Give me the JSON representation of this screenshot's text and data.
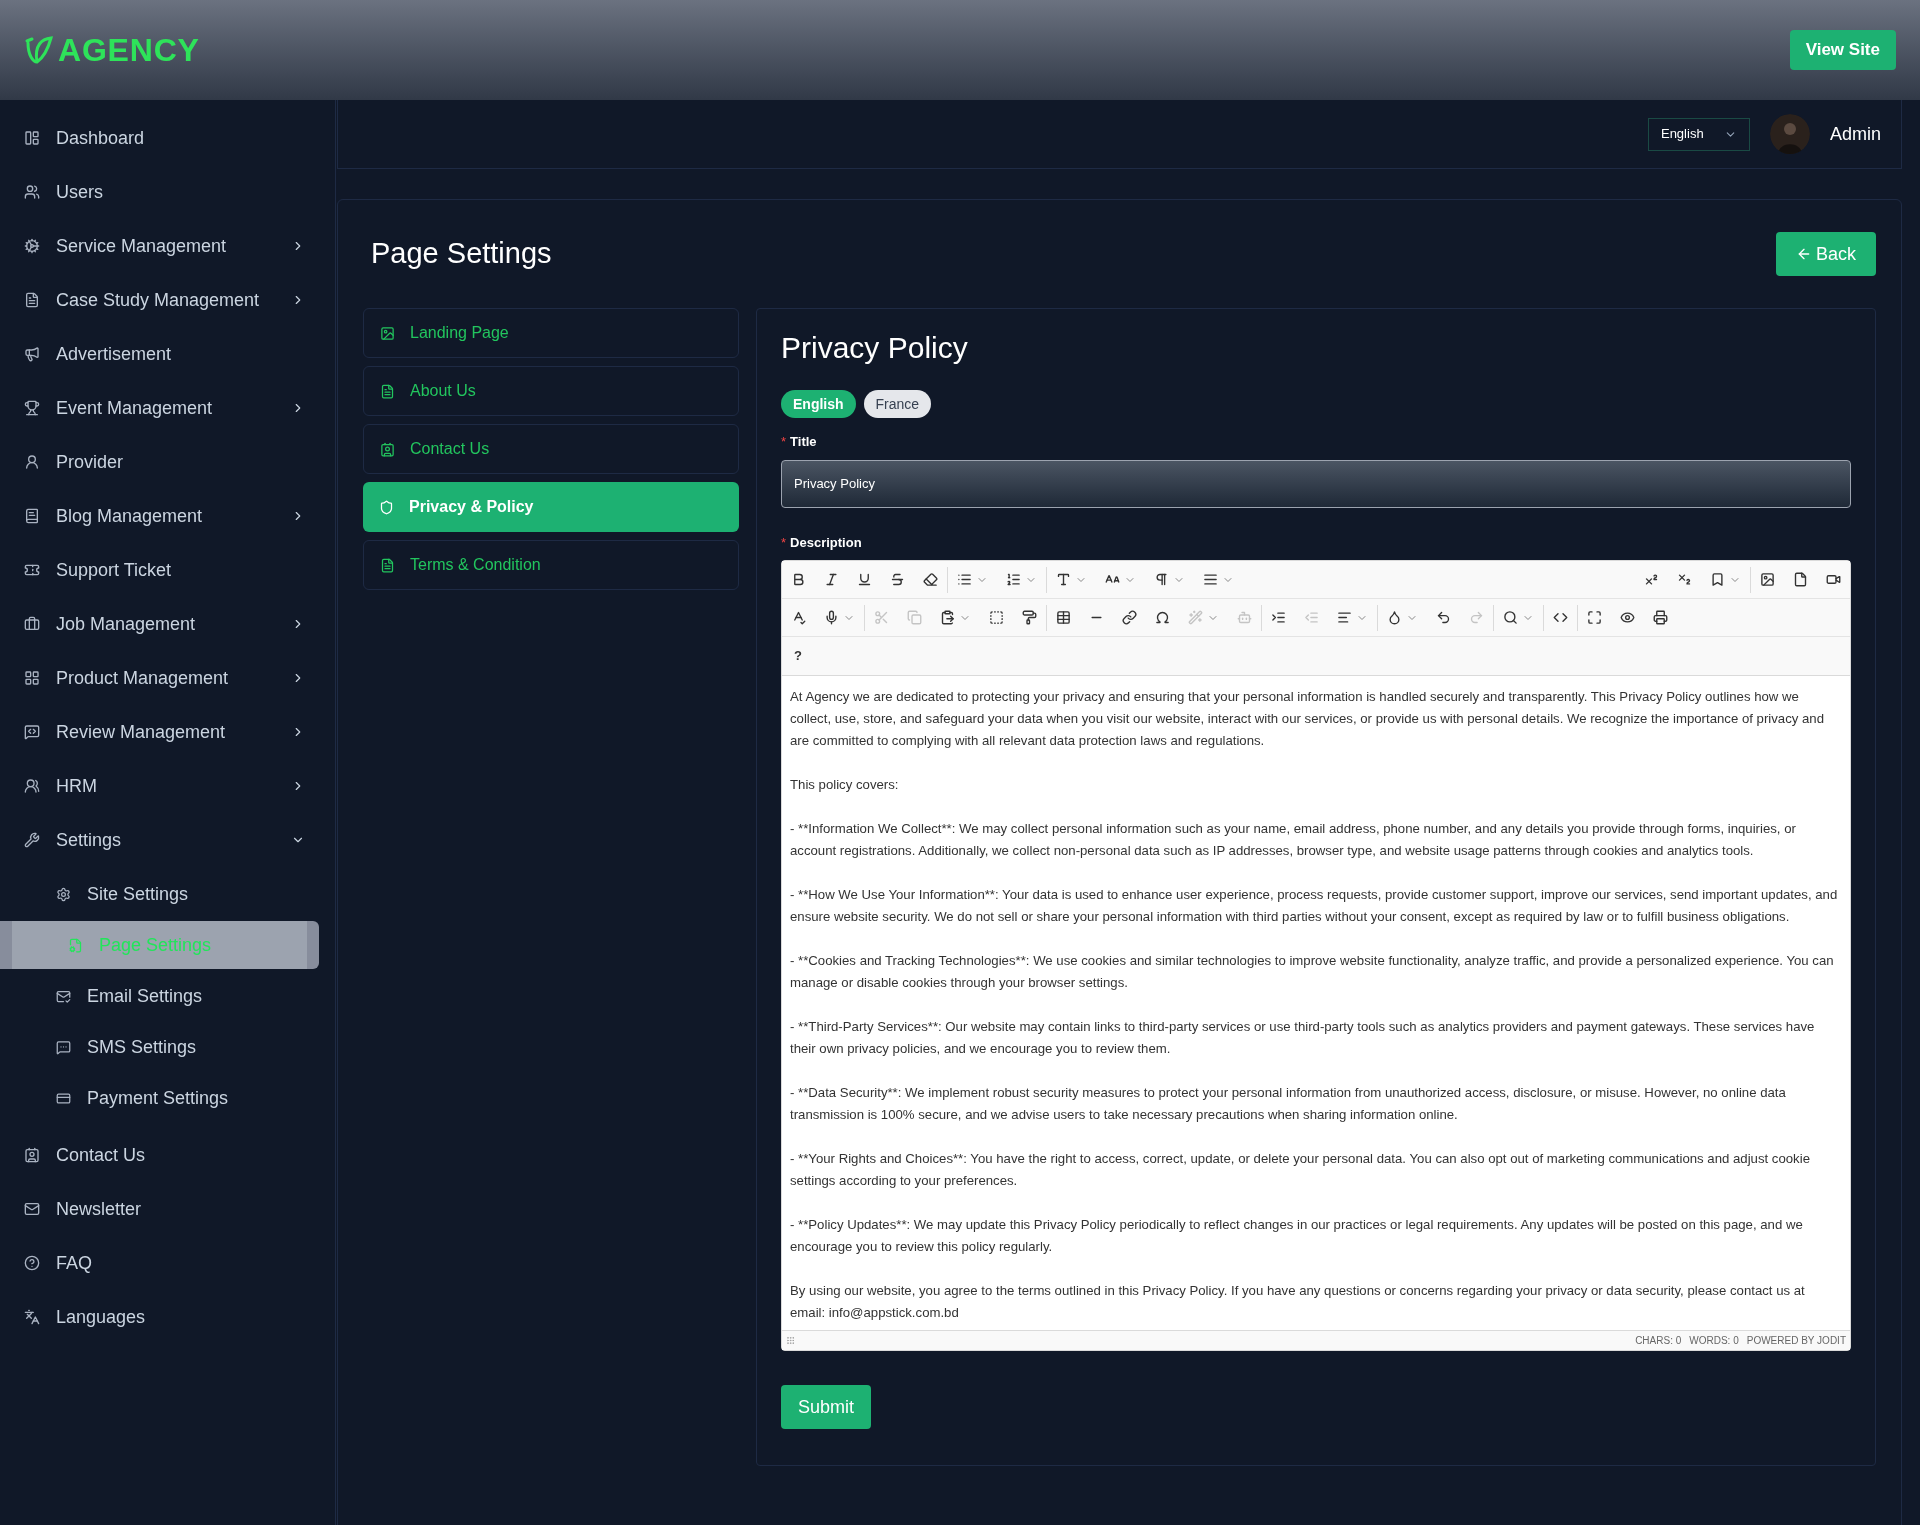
{
  "brand": {
    "name": "AGENCY"
  },
  "header": {
    "view_site": "View Site"
  },
  "sidebar": {
    "items": [
      {
        "label": "Dashboard",
        "selected": false
      },
      {
        "label": "Users",
        "selected": false
      },
      {
        "label": "Service Management",
        "expanded": false,
        "selected": false
      },
      {
        "label": "Case Study Management",
        "expanded": false,
        "selected": false
      },
      {
        "label": "Advertisement",
        "selected": false
      },
      {
        "label": "Event Management",
        "expanded": false,
        "selected": false
      },
      {
        "label": "Provider",
        "selected": false
      },
      {
        "label": "Blog Management",
        "expanded": false,
        "selected": false
      },
      {
        "label": "Support Ticket",
        "selected": false
      },
      {
        "label": "Job Management",
        "expanded": false,
        "selected": false
      },
      {
        "label": "Product Management",
        "expanded": false,
        "selected": false
      },
      {
        "label": "Review Management",
        "expanded": false,
        "selected": false
      },
      {
        "label": "HRM",
        "expanded": false,
        "selected": false
      },
      {
        "label": "Settings",
        "expanded": true,
        "selected": false,
        "children": [
          {
            "label": "Site Settings",
            "selected": false
          },
          {
            "label": "Page Settings",
            "selected": true
          },
          {
            "label": "Email Settings",
            "selected": false
          },
          {
            "label": "SMS Settings",
            "selected": false
          },
          {
            "label": "Payment Settings",
            "selected": false
          }
        ]
      },
      {
        "label": "Contact Us",
        "selected": false
      },
      {
        "label": "Newsletter",
        "selected": false
      },
      {
        "label": "FAQ",
        "selected": false
      },
      {
        "label": "Languages",
        "selected": false
      }
    ]
  },
  "topbar": {
    "language": "English",
    "user": "Admin"
  },
  "page": {
    "title": "Page Settings",
    "back": "Back"
  },
  "tabs": [
    {
      "label": "Landing Page",
      "selected": false
    },
    {
      "label": "About Us",
      "selected": false
    },
    {
      "label": "Contact Us",
      "selected": false
    },
    {
      "label": "Privacy & Policy",
      "selected": true
    },
    {
      "label": "Terms & Condition",
      "selected": false
    }
  ],
  "form": {
    "heading": "Privacy Policy",
    "languages": [
      {
        "label": "English",
        "selected": true
      },
      {
        "label": "France",
        "selected": false
      }
    ],
    "title_required": "*",
    "title_label": "Title",
    "title_value": "Privacy Policy",
    "description_required": "*",
    "description_label": "Description",
    "help": "?",
    "paragraphs": [
      "At Agency we are dedicated to protecting your privacy and ensuring that your personal information is handled securely and transparently. This Privacy Policy outlines how we collect, use, store, and safeguard your data when you visit our website, interact with our services, or provide us with personal details. We recognize the importance of privacy and are committed to complying with all relevant data protection laws and regulations.",
      "This policy covers:",
      "- **Information We Collect**: We may collect personal information such as your name, email address, phone number, and any details you provide through forms, inquiries, or account registrations. Additionally, we collect non-personal data such as IP addresses, browser type, and website usage patterns through cookies and analytics tools.",
      "- **How We Use Your Information**: Your data is used to enhance user experience, process requests, provide customer support, improve our services, send important updates, and ensure website security. We do not sell or share your personal information with third parties without your consent, except as required by law or to fulfill business obligations.",
      "- **Cookies and Tracking Technologies**: We use cookies and similar technologies to improve website functionality, analyze traffic, and provide a personalized experience. You can manage or disable cookies through your browser settings.",
      "- **Third-Party Services**: Our website may contain links to third-party services or use third-party tools such as analytics providers and payment gateways. These services have their own privacy policies, and we encourage you to review them.",
      "- **Data Security**: We implement robust security measures to protect your personal information from unauthorized access, disclosure, or misuse. However, no online data transmission is 100% secure, and we advise users to take necessary precautions when sharing information online.",
      "- **Your Rights and Choices**: You have the right to access, correct, update, or delete your personal data. You can also opt out of marketing communications and adjust cookie settings according to your preferences.",
      "- **Policy Updates**: We may update this Privacy Policy periodically to reflect changes in our practices or legal requirements. Any updates will be posted on this page, and we encourage you to review this policy regularly.",
      "By using our website, you agree to the terms outlined in this Privacy Policy. If you have any questions or concerns regarding your privacy or data security, please contact us at email: info@appstick.com.bd"
    ],
    "stats": [
      "CHARS: 0",
      "WORDS: 0",
      "POWERED BY JODIT"
    ],
    "submit": "Submit"
  }
}
